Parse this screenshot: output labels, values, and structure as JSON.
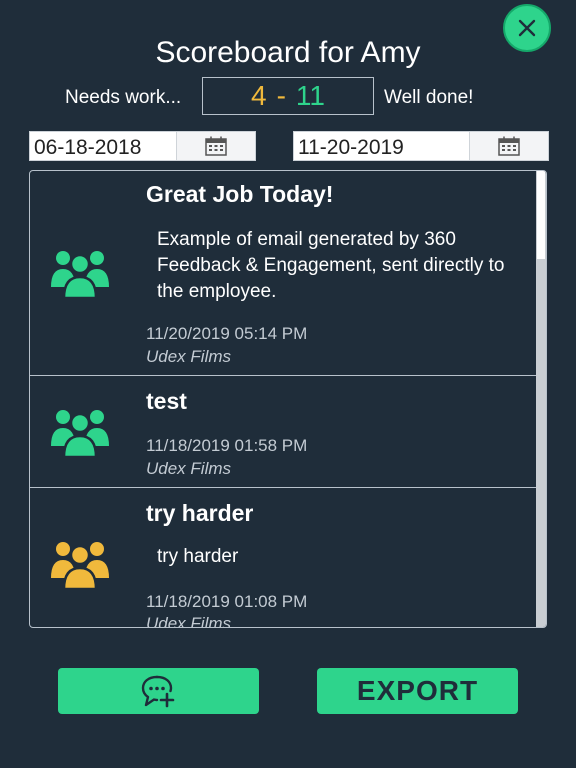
{
  "header": {
    "title": "Scoreboard for Amy",
    "close_icon": "close-x-icon"
  },
  "score": {
    "left_label": "Needs work...",
    "right_label": "Well done!",
    "bad": "4",
    "separator": "-",
    "good": "11",
    "bad_color": "#f0b93c",
    "good_color": "#2ed48c"
  },
  "date_range": {
    "start": "06-18-2018",
    "end": "11-20-2019"
  },
  "feedback": [
    {
      "title": "Great Job Today!",
      "body": "Example of email generated by 360 Feedback & Engagement, sent directly to the employee.",
      "date": "11/20/2019 05:14 PM",
      "company": "Udex Films",
      "icon_color": "#2ed48c"
    },
    {
      "title": "test",
      "body": "",
      "date": "11/18/2019 01:58 PM",
      "company": "Udex Films",
      "icon_color": "#2ed48c"
    },
    {
      "title": "try harder",
      "body": "try harder",
      "date": "11/18/2019 01:08 PM",
      "company": "Udex Films",
      "icon_color": "#f0b93c"
    }
  ],
  "actions": {
    "add_feedback_icon": "chat-plus-icon",
    "export_label": "EXPORT",
    "accent": "#2ed48c"
  }
}
